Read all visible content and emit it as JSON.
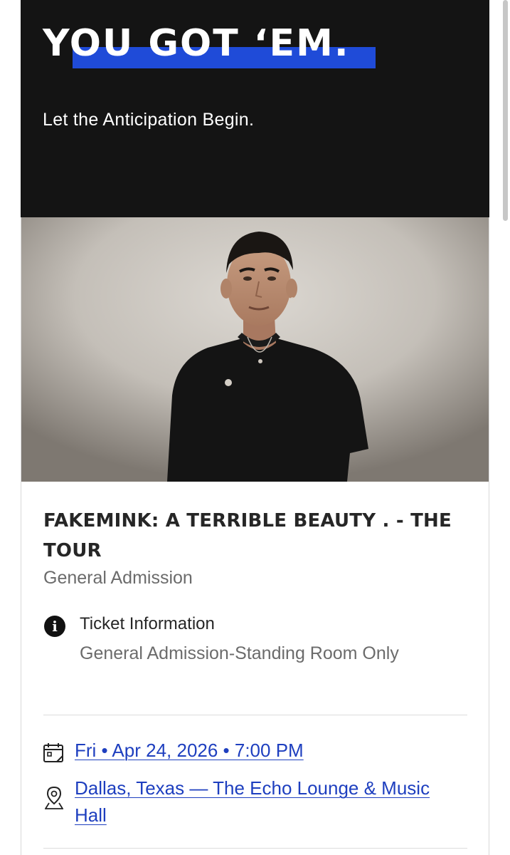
{
  "hero": {
    "title": "YOU GOT ‘EM.",
    "subtitle": "Let the Anticipation Begin.",
    "accent_color": "#1f4bd8",
    "background_color": "#141414"
  },
  "event": {
    "title": "FAKEMINK: A TERRIBLE BEAUTY . - THE TOUR",
    "ticket_type": "General Admission",
    "ticket_info_label": "Ticket Information",
    "ticket_info_value": "General Admission-Standing Room Only",
    "datetime": "Fri • Apr 24, 2026 • 7:00 PM",
    "venue": "Dallas, Texas — The Echo Lounge & Music Hall",
    "link_color": "#1e3fbf"
  },
  "icons": {
    "info": "info-icon",
    "calendar": "calendar-icon",
    "location": "location-pin-icon"
  }
}
